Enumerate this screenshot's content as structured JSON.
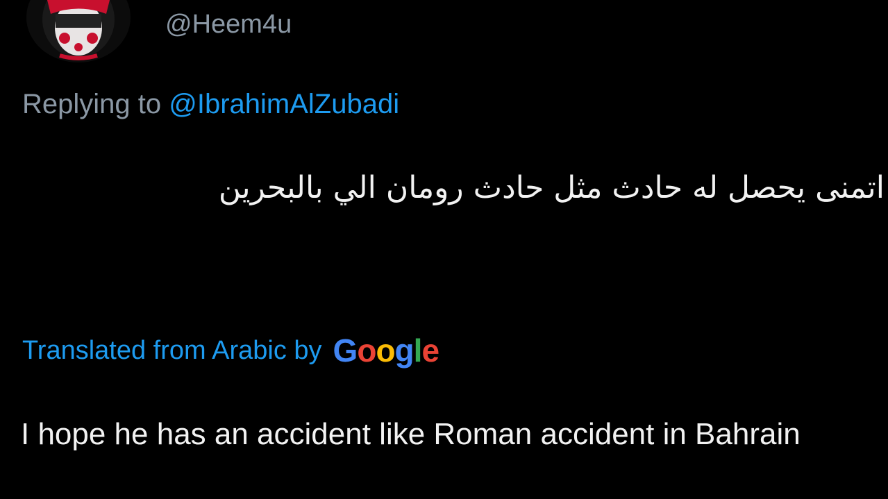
{
  "tweet": {
    "handle": "@Heem4u",
    "replying_prefix": "Replying to ",
    "replying_to": "@IbrahimAlZubadi",
    "original_text": "اتمنى يحصل له حادث مثل حادث رومان الي بالبحرين",
    "translation_label": "Translated from Arabic by",
    "translation_provider": "Google",
    "translated_text": "I hope he has an accident like Roman accident in Bahrain"
  },
  "colors": {
    "background": "#000000",
    "primary_text": "#e7e9ea",
    "secondary_text": "#8b98a5",
    "accent": "#1d9bf0",
    "google_blue": "#4285f4",
    "google_red": "#ea4335",
    "google_yellow": "#fbbc05",
    "google_green": "#34a853"
  },
  "icons": {
    "avatar": "profile-avatar"
  }
}
